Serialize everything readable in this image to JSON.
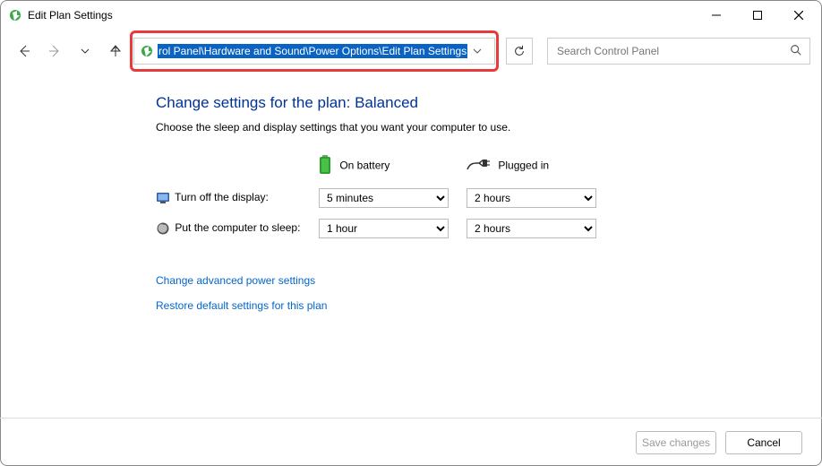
{
  "window": {
    "title": "Edit Plan Settings"
  },
  "address_bar": {
    "path_visible": "rol Panel\\Hardware and Sound\\Power Options\\Edit Plan Settings"
  },
  "search": {
    "placeholder": "Search Control Panel"
  },
  "page": {
    "heading": "Change settings for the plan: Balanced",
    "subtitle": "Choose the sleep and display settings that you want your computer to use.",
    "col_battery": "On battery",
    "col_plugged": "Plugged in",
    "row_display": "Turn off the display:",
    "row_sleep": "Put the computer to sleep:",
    "display_battery_value": "5 minutes",
    "display_plugged_value": "2 hours",
    "sleep_battery_value": "1 hour",
    "sleep_plugged_value": "2 hours",
    "link_advanced": "Change advanced power settings",
    "link_restore": "Restore default settings for this plan",
    "btn_save": "Save changes",
    "btn_cancel": "Cancel"
  }
}
